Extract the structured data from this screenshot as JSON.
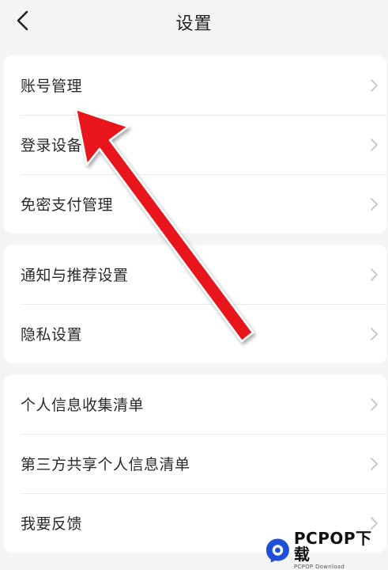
{
  "header": {
    "title": "设置",
    "back_icon": "chevron-left-icon"
  },
  "groups": [
    {
      "items": [
        {
          "label": "账号管理"
        },
        {
          "label": "登录设备管理"
        },
        {
          "label": "免密支付管理"
        }
      ]
    },
    {
      "items": [
        {
          "label": "通知与推荐设置"
        },
        {
          "label": "隐私设置"
        }
      ]
    },
    {
      "items": [
        {
          "label": "个人信息收集清单"
        },
        {
          "label": "第三方共享个人信息清单"
        },
        {
          "label": "我要反馈"
        }
      ]
    }
  ],
  "colors": {
    "background": "#f4f4f4",
    "card": "#ffffff",
    "annotation_arrow": "#e8191b"
  },
  "watermark": {
    "main": "PCPOP下载",
    "sub": "PCPOP Download"
  }
}
